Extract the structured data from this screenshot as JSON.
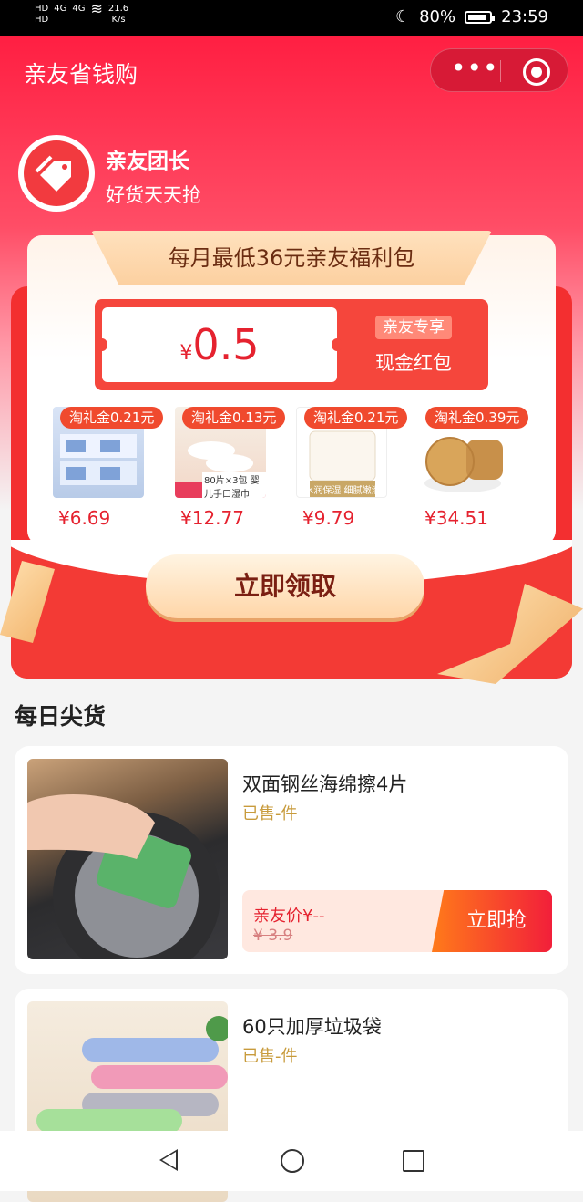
{
  "status_bar": {
    "left": [
      "HD₁",
      "4G",
      "4G",
      "wifi"
    ],
    "speed": "21.6",
    "speed_unit": "K/s",
    "battery": "80%",
    "time": "23:59"
  },
  "header": {
    "title": "亲友省钱购",
    "more_icon": "•••"
  },
  "shop": {
    "name": "亲友团长",
    "subtitle": "好货天天抢"
  },
  "promo": {
    "banner": "每月最低36元亲友福利包",
    "redpack": {
      "yen": "¥",
      "amount": "0.5",
      "tag": "亲友专享",
      "label": "现金红包"
    },
    "products": [
      {
        "badge": "淘礼金0.21元",
        "price": "¥6.69",
        "caption": ""
      },
      {
        "badge": "淘礼金0.13元",
        "price": "¥12.77",
        "caption": "80片×3包 婴儿手口湿巾"
      },
      {
        "badge": "淘礼金0.21元",
        "price": "¥9.79",
        "caption": "水润保湿 细腻嫩滑"
      },
      {
        "badge": "淘礼金0.39元",
        "price": "¥34.51",
        "caption": ""
      }
    ],
    "claim_button": "立即领取"
  },
  "section": {
    "title": "每日尖货"
  },
  "items": [
    {
      "name": "双面钢丝海绵擦4片",
      "sold": "已售-件",
      "friend_price": "亲友价¥--",
      "original_price": "¥ 3.9",
      "buy_button": "立即抢"
    },
    {
      "name": "60只加厚垃圾袋",
      "sold": "已售-件"
    }
  ],
  "colors": {
    "primary_red": "#ff1f42",
    "accent_gold": "#c89b3c"
  }
}
